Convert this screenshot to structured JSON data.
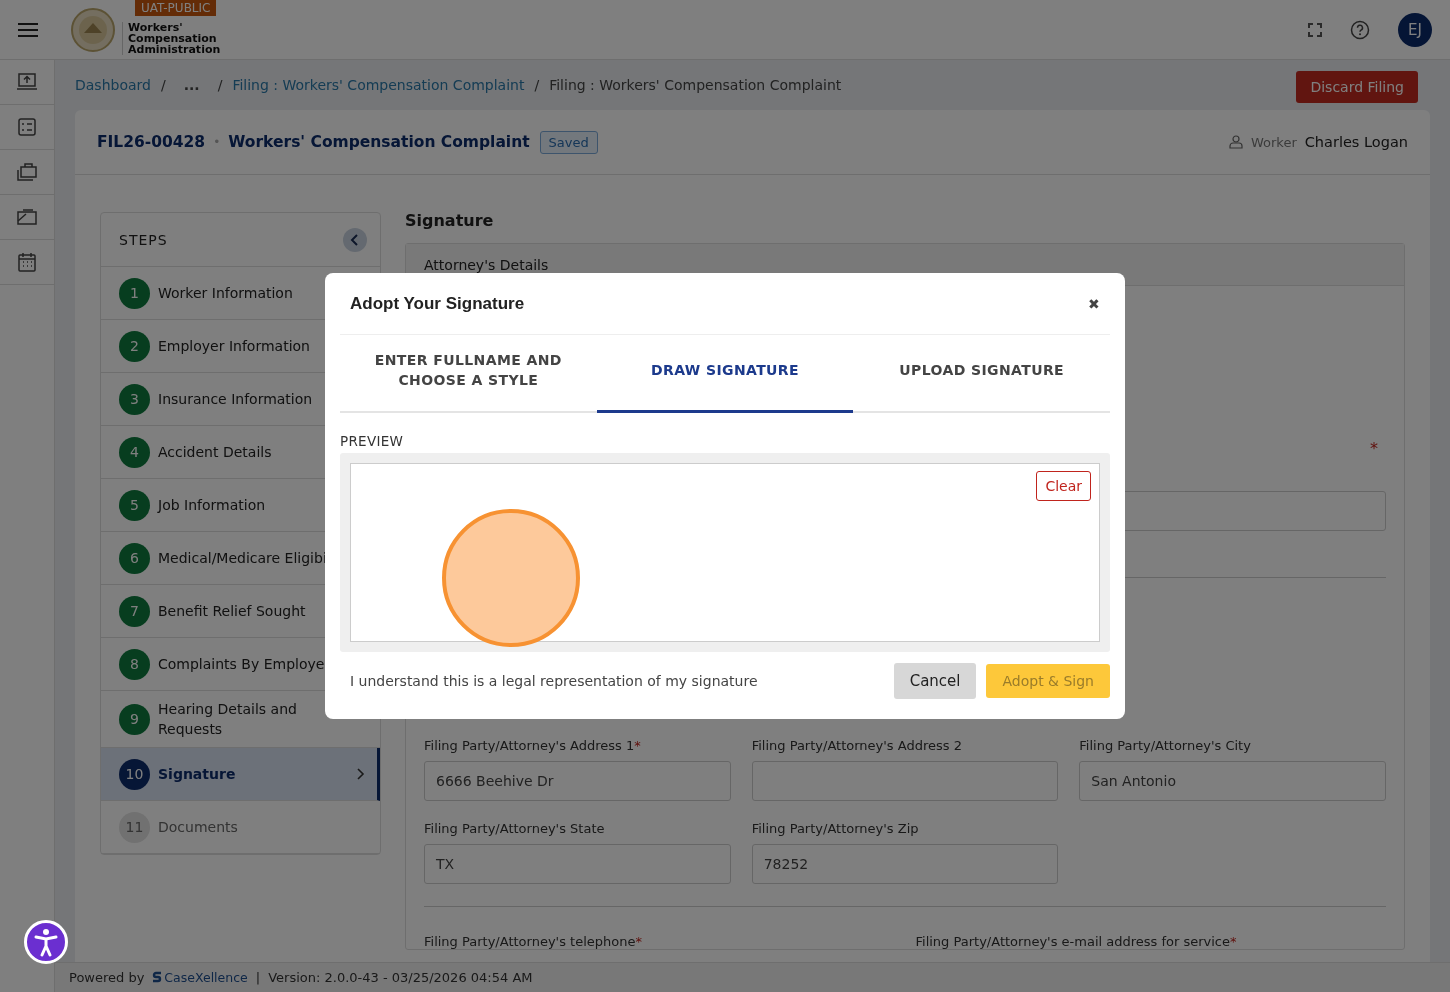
{
  "header": {
    "badge": "UAT-PUBLIC",
    "logo_lines": [
      "Workers'",
      "Compensation",
      "Administration"
    ],
    "avatar": "EJ"
  },
  "breadcrumb": {
    "items": [
      {
        "label": "Dashboard",
        "link": true
      },
      {
        "label": "...",
        "link": false
      },
      {
        "label": "Filing : Workers' Compensation Complaint",
        "link": true
      },
      {
        "label": "Filing : Workers' Compensation Complaint",
        "link": false
      }
    ],
    "separators": [
      "/",
      "/",
      "/"
    ]
  },
  "discard_button": "Discard Filing",
  "filing": {
    "id": "FIL26-00428",
    "dot": "•",
    "title": "Workers' Compensation Complaint",
    "status": "Saved",
    "worker_label": "Worker",
    "worker_name": "Charles Logan"
  },
  "steps": {
    "title": "STEPS",
    "items": [
      {
        "number": "1",
        "label": "Worker Information",
        "kind": "complete",
        "selected": false
      },
      {
        "number": "2",
        "label": "Employer Information",
        "kind": "complete",
        "selected": false
      },
      {
        "number": "3",
        "label": "Insurance Information",
        "kind": "complete",
        "selected": false
      },
      {
        "number": "4",
        "label": "Accident Details",
        "kind": "complete",
        "selected": false
      },
      {
        "number": "5",
        "label": "Job Information",
        "kind": "complete",
        "selected": false
      },
      {
        "number": "6",
        "label": "Medical/Medicare Eligibi",
        "kind": "complete",
        "selected": false
      },
      {
        "number": "7",
        "label": "Benefit Relief Sought",
        "kind": "complete",
        "selected": false
      },
      {
        "number": "8",
        "label": "Complaints By Employe",
        "kind": "complete",
        "selected": false
      },
      {
        "number": "9",
        "label": "Hearing Details and Requests",
        "kind": "complete",
        "selected": false
      },
      {
        "number": "10",
        "label": "Signature",
        "kind": "current",
        "selected": true
      },
      {
        "number": "11",
        "label": "Documents",
        "kind": "pending",
        "selected": false
      }
    ]
  },
  "section": {
    "title": "Signature",
    "panel_title": "Attorney's Details",
    "required_mark": "*",
    "fields": [
      {
        "label": "Filing Party/Attorney's Address 1",
        "required": true,
        "value": "6666 Beehive Dr"
      },
      {
        "label": "Filing Party/Attorney's Address 2",
        "required": false
      },
      {
        "label": "Filing Party/Attorney's City",
        "required": false,
        "value": "San Antonio"
      },
      {
        "label": "Filing Party/Attorney's State",
        "required": false,
        "value": "TX"
      },
      {
        "label": "Filing Party/Attorney's Zip",
        "required": false,
        "value": "78252"
      }
    ],
    "contact_fields": [
      {
        "label": "Filing Party/Attorney's telephone",
        "required": true
      },
      {
        "label": "Filing Party/Attorney's e-mail address for service",
        "required": true
      }
    ]
  },
  "modal": {
    "title": "Adopt Your Signature",
    "close": "✖",
    "tabs": [
      {
        "label": "ENTER FULLNAME AND CHOOSE A STYLE",
        "selected": false
      },
      {
        "label": "DRAW SIGNATURE",
        "selected": true
      },
      {
        "label": "UPLOAD SIGNATURE",
        "selected": false
      }
    ],
    "preview_label": "PREVIEW",
    "clear": "Clear",
    "notice": "I understand this is a legal representation of my signature",
    "cancel": "Cancel",
    "adopt": {
      "label": "Adopt & Sign",
      "disabled": true
    }
  },
  "footer": {
    "powered_by": "Powered by",
    "brand": "CaseXellence",
    "separator": "|",
    "version": "Version: 2.0.0-43 - 03/25/2026 04:54 AM"
  }
}
